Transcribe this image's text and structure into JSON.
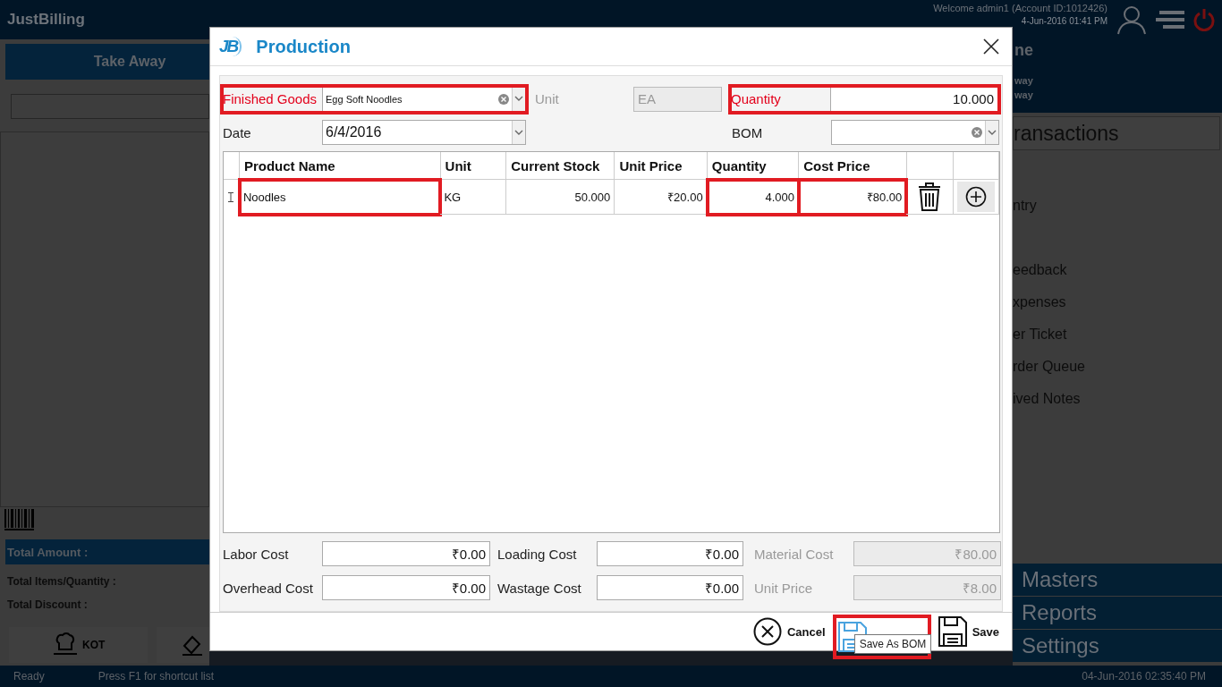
{
  "header": {
    "logo": "JustBilling",
    "welcome": "Welcome admin1 (Account ID:1012426)",
    "login_time": "4-Jun-2016 01:41 PM"
  },
  "left_panel": {
    "order_type": "Take Away",
    "total_amount_label": "Total Amount :",
    "totals": [
      "Total Items/Quantity :",
      "Total Discount :"
    ],
    "kot_button": "KOT"
  },
  "right_panel": {
    "title": "ne",
    "subtitles": [
      "way",
      "way"
    ],
    "section": "ransactions",
    "menu_items": [
      "ntry",
      "eedback",
      "xpenses",
      "er Ticket",
      "rder Queue",
      "ived Notes"
    ],
    "nav_buttons": [
      "Masters",
      "Reports",
      "Settings"
    ]
  },
  "dialog": {
    "logo": "JB",
    "title": "Production",
    "finished_goods": {
      "label": "Finished Goods",
      "value": "Egg Soft Noodles",
      "required": true,
      "highlighted": true
    },
    "unit": {
      "label": "Unit",
      "value": "EA",
      "disabled": true
    },
    "quantity": {
      "label": "Quantity",
      "value": "10.000",
      "required": true,
      "highlighted": true
    },
    "date": {
      "label": "Date",
      "value": "6/4/2016",
      "required": false
    },
    "bom": {
      "label": "BOM",
      "required": false
    },
    "table": {
      "columns": [
        "Product Name",
        "Unit",
        "Current Stock",
        "Unit Price",
        "Quantity",
        "Cost Price"
      ],
      "rows": [
        {
          "editing": true,
          "cells": [
            {
              "text": "Noodles",
              "highlighted": true
            },
            {
              "text": "KG",
              "highlighted": false
            },
            {
              "text": "50.000",
              "highlighted": false
            },
            {
              "text": "₹20.00",
              "highlighted": false
            },
            {
              "text": "4.000",
              "highlighted": true
            },
            {
              "text": "₹80.00",
              "highlighted": true
            }
          ]
        }
      ]
    },
    "costs": [
      {
        "label": "Labor Cost",
        "value": "₹0.00",
        "disabled": false
      },
      {
        "label": "Loading Cost",
        "value": "₹0.00",
        "disabled": false
      },
      {
        "label": "Material Cost",
        "value": "₹80.00",
        "disabled": true
      },
      {
        "label": "Overhead Cost",
        "value": "₹0.00",
        "disabled": false
      },
      {
        "label": "Wastage Cost",
        "value": "₹0.00",
        "disabled": false
      },
      {
        "label": "Unit Price",
        "value": "₹8.00",
        "disabled": true
      }
    ],
    "buttons": [
      {
        "kind": "cancel",
        "label": "Cancel"
      },
      {
        "kind": "save_bom",
        "tooltip": "Save As BOM",
        "highlighted": true
      },
      {
        "kind": "save",
        "label": "Save"
      }
    ]
  },
  "status_bar": {
    "status": "Ready",
    "hint": "Press F1 for shortcut list",
    "datetime": "04-Jun-2016 02:35:40 PM"
  }
}
